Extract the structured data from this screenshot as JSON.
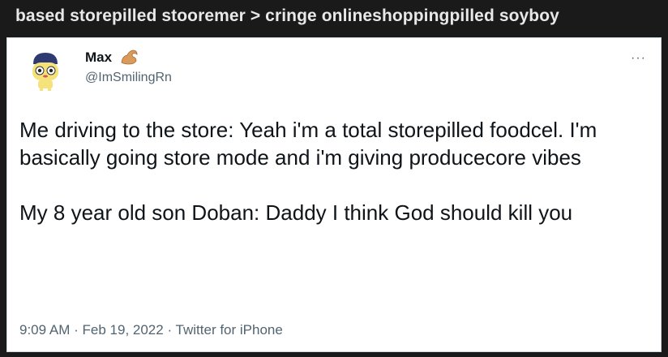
{
  "post": {
    "title": "based storepilled stooremer > cringe onlineshoppingpilled soyboy"
  },
  "tweet": {
    "display_name": "Max",
    "handle": "@ImSmilingRn",
    "more_icon": "more-horizontal-icon",
    "more_label": "···",
    "paragraphs": [
      "Me driving to the store: Yeah i'm a total storepilled foodcel. I'm basically going store mode and i'm giving producecore vibes",
      "My 8 year old son Doban: Daddy I think God should kill you"
    ],
    "time": "9:09 AM",
    "separator": "·",
    "date": "Feb 19, 2022",
    "source": "Twitter for iPhone"
  },
  "colors": {
    "background": "#1a1a1b",
    "card": "#ffffff",
    "text": "#0f1419",
    "muted": "#536471"
  }
}
